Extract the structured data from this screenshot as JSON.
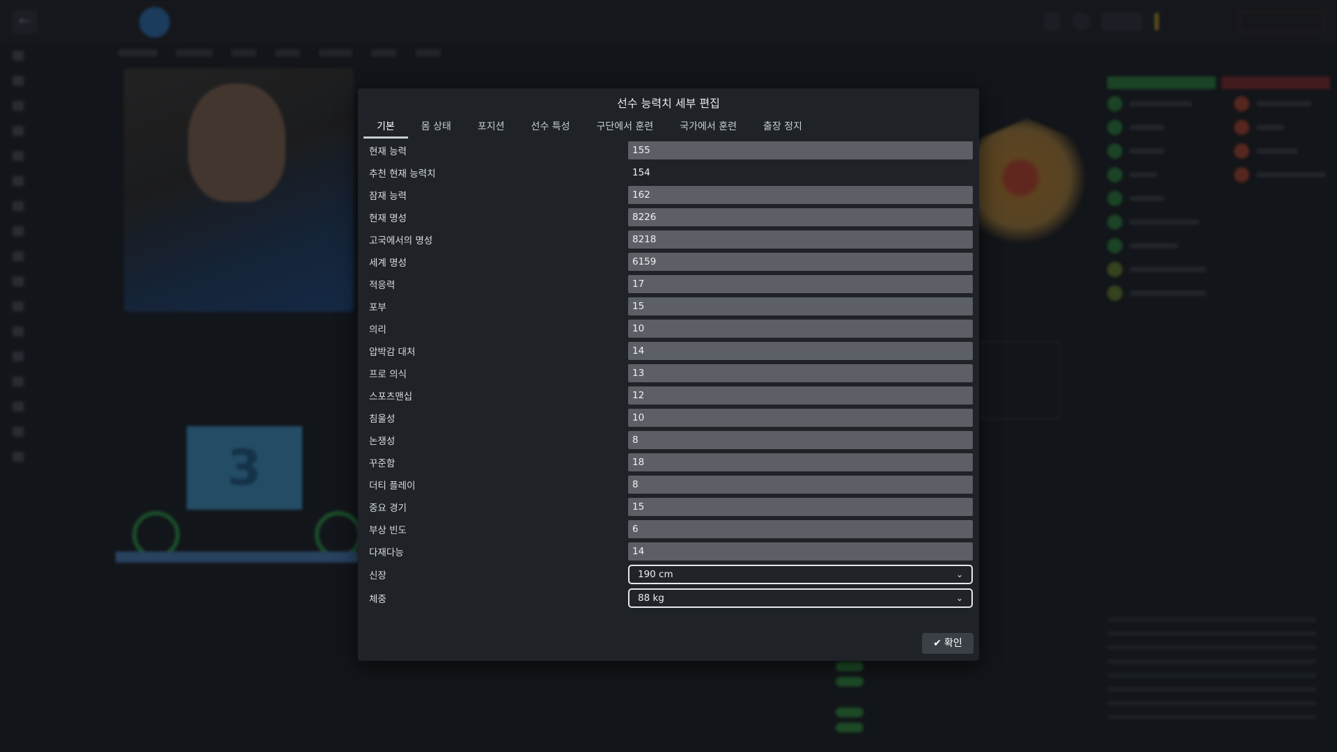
{
  "modal": {
    "title": "선수 능력치 세부 편집",
    "tabs": [
      {
        "label": "기본",
        "active": true
      },
      {
        "label": "몸 상태",
        "active": false
      },
      {
        "label": "포지션",
        "active": false
      },
      {
        "label": "선수 특성",
        "active": false
      },
      {
        "label": "구단에서 훈련",
        "active": false
      },
      {
        "label": "국가에서 훈련",
        "active": false
      },
      {
        "label": "출장 정지",
        "active": false
      }
    ],
    "fields": [
      {
        "label": "현재 능력",
        "value": "155"
      },
      {
        "label": "추천 현재 능력치",
        "value": "154"
      },
      {
        "label": "잠재 능력",
        "value": "162"
      },
      {
        "label": "현재 명성",
        "value": "8226"
      },
      {
        "label": "고국에서의 명성",
        "value": "8218"
      },
      {
        "label": "세계 명성",
        "value": "6159"
      },
      {
        "label": "적응력",
        "value": "17"
      },
      {
        "label": "포부",
        "value": "15"
      },
      {
        "label": "의리",
        "value": "10"
      },
      {
        "label": "압박감 대처",
        "value": "14"
      },
      {
        "label": "프로 의식",
        "value": "13"
      },
      {
        "label": "스포츠맨십",
        "value": "12"
      },
      {
        "label": "침울성",
        "value": "10"
      },
      {
        "label": "논쟁성",
        "value": "8"
      },
      {
        "label": "꾸준함",
        "value": "18"
      },
      {
        "label": "더티 플레이",
        "value": "8"
      },
      {
        "label": "중요 경기",
        "value": "15"
      },
      {
        "label": "부상 빈도",
        "value": "6"
      },
      {
        "label": "다재다능",
        "value": "14"
      }
    ],
    "selects": [
      {
        "label": "신장",
        "value": "190 cm"
      },
      {
        "label": "체중",
        "value": "88 kg"
      }
    ],
    "confirm_label": "확인"
  },
  "background": {
    "kit_number": "3"
  },
  "colors": {
    "modal_bg": "#1f2328",
    "field_bg": "#5c6066",
    "accent_green": "#2aa84a",
    "club_blue": "#2b78c2"
  }
}
